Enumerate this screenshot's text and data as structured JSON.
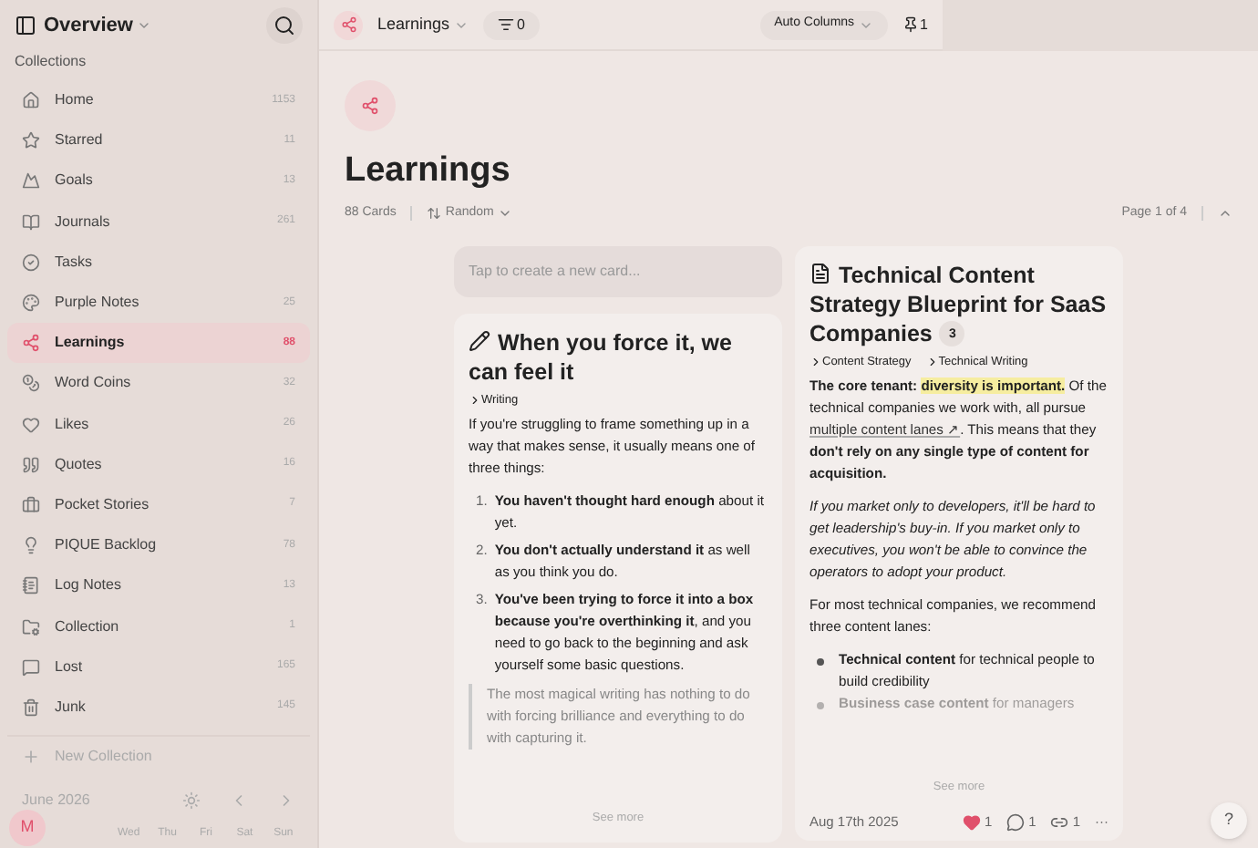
{
  "sidebar": {
    "title": "Overview",
    "section": "Collections",
    "items": [
      {
        "label": "Home",
        "count": "1153",
        "selected": false
      },
      {
        "label": "Starred",
        "count": "11",
        "selected": false
      },
      {
        "label": "Goals",
        "count": "13",
        "selected": false
      },
      {
        "label": "Journals",
        "count": "261",
        "selected": false
      },
      {
        "label": "Tasks",
        "selected": false
      },
      {
        "label": "Purple Notes",
        "count": "25",
        "selected": false
      },
      {
        "label": "Learnings",
        "count": "88",
        "selected": true
      },
      {
        "label": "Word Coins",
        "count": "32",
        "selected": false
      },
      {
        "label": "Likes",
        "count": "26",
        "selected": false
      },
      {
        "label": "Quotes",
        "count": "16",
        "selected": false
      },
      {
        "label": "Pocket Stories",
        "count": "7",
        "selected": false
      },
      {
        "label": "PIQUE Backlog",
        "count": "78",
        "selected": false
      },
      {
        "label": "Log Notes",
        "count": "13",
        "selected": false
      },
      {
        "label": "Collection",
        "count": "1",
        "selected": false
      },
      {
        "label": "Lost",
        "count": "165",
        "selected": false
      },
      {
        "label": "Junk",
        "count": "145",
        "selected": false
      }
    ],
    "new_collection": "New Collection",
    "calendar": {
      "month": "June 2026",
      "days": [
        "Wed",
        "Thu",
        "Fri",
        "Sat",
        "Sun"
      ]
    },
    "avatar": "M"
  },
  "toolbar": {
    "collection": "Learnings",
    "filter_count": "0",
    "columns": "Auto Columns",
    "pinned_count": "1"
  },
  "header": {
    "title": "Learnings",
    "card_count": "88 Cards",
    "sort": "Random",
    "page": "Page 1 of 4"
  },
  "new_card": {
    "placeholder": "Tap to create a new card..."
  },
  "cards": [
    {
      "kind": "note",
      "title": "When you force it, we can feel it",
      "tags": [
        "Writing"
      ],
      "blocks": [
        {
          "kind": "paragraph",
          "segments": [
            {
              "kind": "text",
              "text": "If you're struggling to frame something up in a way that makes sense, it usually means one of three things:"
            }
          ]
        },
        {
          "kind": "numbered",
          "marker": "1.",
          "segments": [
            {
              "kind": "text",
              "text": "**You haven't thought hard enough** about it yet."
            }
          ]
        },
        {
          "kind": "numbered",
          "marker": "2.",
          "segments": [
            {
              "kind": "text",
              "text": "**You don't actually understand it** as well as you think you do."
            }
          ]
        },
        {
          "kind": "numbered",
          "marker": "3.",
          "segments": [
            {
              "kind": "text",
              "text": "**You've been trying to force it into a box because you're overthinking it**, and you need to go back to the beginning and ask yourself some basic questions."
            }
          ]
        },
        {
          "kind": "quote",
          "segments": [
            {
              "kind": "text",
              "text": "The most magical writing has nothing to do with forcing brilliance and everything to do with capturing it."
            }
          ]
        }
      ],
      "see_more": "See more"
    },
    {
      "kind": "document",
      "title": "Technical Content Strategy Blueprint for SaaS Companies",
      "badge": "3",
      "tags": [
        "Content Strategy",
        "Technical Writing"
      ],
      "blocks": [
        {
          "kind": "paragraph",
          "segments": [
            {
              "kind": "text",
              "text": "**The core tenant:** "
            },
            {
              "kind": "highlight",
              "text": "diversity is important."
            },
            {
              "kind": "text",
              "text": " Of the technical companies we work with, all pursue "
            },
            {
              "kind": "link",
              "text": "multiple content lanes ↗"
            },
            {
              "kind": "text",
              "text": ". This means that they **don't rely on any single type of content for acquisition.**"
            }
          ]
        },
        {
          "kind": "paragraph",
          "segments": [
            {
              "kind": "text",
              "text": "*If you market only to developers, it'll be hard to get leadership's buy-in. If you market only to executives, you won't be able to convince the operators to adopt your product.*"
            }
          ]
        },
        {
          "kind": "paragraph",
          "segments": [
            {
              "kind": "text",
              "text": "For most technical companies, we recommend three content lanes:"
            }
          ]
        },
        {
          "kind": "bullet",
          "faded": false,
          "segments": [
            {
              "kind": "text",
              "text": "**Technical content** for technical people to build credibility"
            }
          ]
        },
        {
          "kind": "bullet",
          "faded": true,
          "segments": [
            {
              "kind": "text",
              "text": "**Business case content** for managers"
            }
          ]
        }
      ],
      "see_more": "See more",
      "footer": {
        "date": "Aug 17th 2025",
        "likes": "1",
        "comments": "1",
        "links": "1",
        "more": "···"
      }
    }
  ],
  "help": "?"
}
